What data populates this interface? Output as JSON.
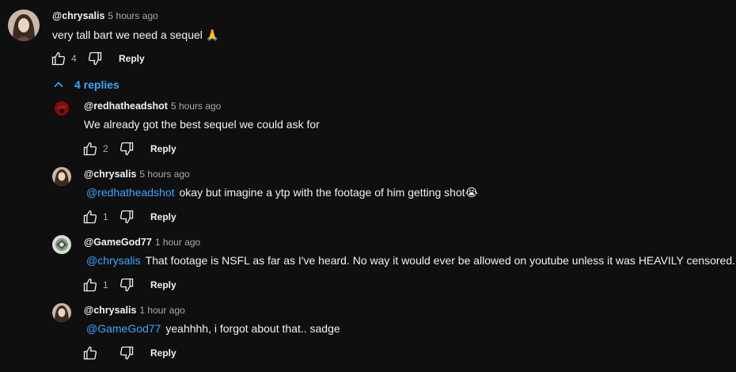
{
  "top_comment": {
    "author": "@chrysalis",
    "time": "5 hours ago",
    "text": "very tall bart we need a sequel",
    "emoji": "🙏",
    "likes": "4",
    "reply_label": "Reply"
  },
  "replies_toggle": {
    "label": "4 replies"
  },
  "replies": [
    {
      "author": "@redhatheadshot",
      "time": "5 hours ago",
      "mention": "",
      "text": "We already got the best sequel we could ask for",
      "emoji": "",
      "likes": "2",
      "reply_label": "Reply"
    },
    {
      "author": "@chrysalis",
      "time": "5 hours ago",
      "mention": "@redhatheadshot",
      "text": "okay but imagine a ytp with the footage of him getting shot",
      "emoji": "😭",
      "likes": "1",
      "reply_label": "Reply"
    },
    {
      "author": "@GameGod77",
      "time": "1 hour ago",
      "mention": "@chrysalis",
      "text": "That footage is NSFL as far as I've heard. No way it would ever be allowed on youtube unless it was HEAVILY censored.",
      "emoji": "",
      "likes": "1",
      "reply_label": "Reply"
    },
    {
      "author": "@chrysalis",
      "time": "1 hour ago",
      "mention": "@GameGod77",
      "text": "yeahhhh, i forgot about that.. sadge",
      "emoji": "",
      "likes": "",
      "reply_label": "Reply"
    }
  ],
  "colors": {
    "background": "#0f0f0f",
    "text": "#f1f1f1",
    "secondary": "#aaaaaa",
    "link": "#3ea6ff"
  },
  "icons": {
    "like": "thumbs-up-icon",
    "dislike": "thumbs-down-icon",
    "collapse": "chevron-up-icon"
  }
}
